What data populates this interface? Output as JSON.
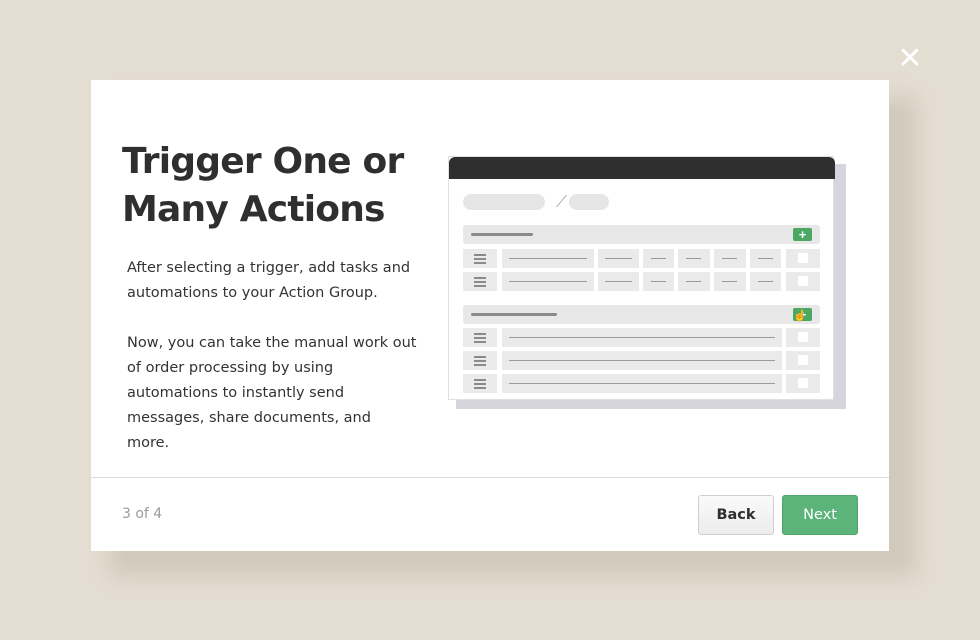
{
  "dialog": {
    "close_icon": "close-icon",
    "title": "Trigger One or Many Actions",
    "paragraphs": [
      "After selecting a trigger, add tasks and automations to your Action Group.",
      "Now, you can take the manual work out of order processing by using automations to instantly send messages, share documents, and more."
    ],
    "step_indicator": "3 of 4",
    "back_label": "Back",
    "next_label": "Next"
  },
  "illustration": {
    "plus_glyph": "+",
    "icons": [
      "drag-handle-icon",
      "checkbox-icon",
      "add-icon",
      "pointer-cursor-icon"
    ]
  },
  "colors": {
    "backdrop": "#e4ddd1",
    "primary_button": "#5cb47a",
    "add_button": "#4aa862",
    "window_bar": "#2f2f2f"
  }
}
